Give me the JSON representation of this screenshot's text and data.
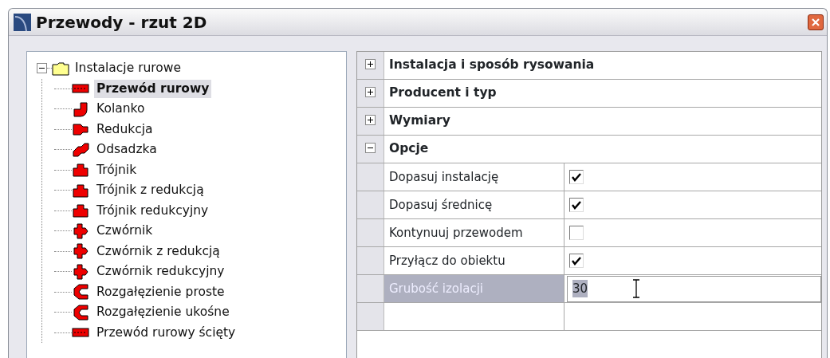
{
  "window": {
    "title": "Przewody - rzut 2D"
  },
  "tree": {
    "label": "Instalacje rurowe",
    "expanded": true,
    "children": [
      {
        "label": "Przewód rurowy",
        "kind": "pipe",
        "selected": true
      },
      {
        "label": "Kolanko",
        "kind": "elbow",
        "selected": false
      },
      {
        "label": "Redukcja",
        "kind": "reducer",
        "selected": false
      },
      {
        "label": "Odsadzka",
        "kind": "offset",
        "selected": false
      },
      {
        "label": "Trójnik",
        "kind": "tee",
        "selected": false
      },
      {
        "label": "Trójnik z redukcją",
        "kind": "tee",
        "selected": false
      },
      {
        "label": "Trójnik redukcyjny",
        "kind": "tee",
        "selected": false
      },
      {
        "label": "Czwórnik",
        "kind": "cross",
        "selected": false
      },
      {
        "label": "Czwórnik z redukcją",
        "kind": "cross",
        "selected": false
      },
      {
        "label": "Czwórnik redukcyjny",
        "kind": "cross",
        "selected": false
      },
      {
        "label": "Rozgałęzienie proste",
        "kind": "branch",
        "selected": false
      },
      {
        "label": "Rozgałęzienie ukośne",
        "kind": "branch",
        "selected": false
      },
      {
        "label": "Przewód rurowy ścięty",
        "kind": "pipe",
        "selected": false
      }
    ]
  },
  "properties": [
    {
      "label": "Instalacja i sposób rysowania",
      "expanded": false
    },
    {
      "label": "Producent i typ",
      "expanded": false
    },
    {
      "label": "Wymiary",
      "expanded": false
    },
    {
      "label": "Opcje",
      "expanded": true,
      "rows": [
        {
          "label": "Dopasuj instalację",
          "kind": "checkbox",
          "checked": true,
          "selected": false
        },
        {
          "label": "Dopasuj średnicę",
          "kind": "checkbox",
          "checked": true,
          "selected": false
        },
        {
          "label": "Kontynuuj przewodem",
          "kind": "checkbox",
          "checked": false,
          "selected": false
        },
        {
          "label": "Przyłącz do obiektu",
          "kind": "checkbox",
          "checked": true,
          "selected": false
        },
        {
          "label": "Grubość izolacji",
          "kind": "text",
          "value": "30",
          "selected": true
        }
      ]
    }
  ]
}
